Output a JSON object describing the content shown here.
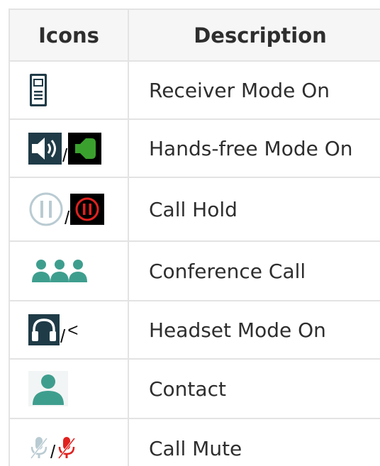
{
  "table": {
    "headers": {
      "icons": "Icons",
      "description": "Description"
    },
    "rows": [
      {
        "icons": [
          "receiver-icon"
        ],
        "separator": "",
        "suffix": "",
        "description": "Receiver Mode On"
      },
      {
        "icons": [
          "speaker-icon",
          "speaker-active-icon"
        ],
        "separator": "/",
        "suffix": "",
        "description": "Hands-free Mode On"
      },
      {
        "icons": [
          "pause-icon",
          "pause-active-icon"
        ],
        "separator": "/",
        "suffix": "",
        "description": "Call Hold"
      },
      {
        "icons": [
          "conference-icon"
        ],
        "separator": "",
        "suffix": "",
        "description": "Conference Call"
      },
      {
        "icons": [
          "headset-icon"
        ],
        "separator": "/",
        "suffix": "<",
        "description": "Headset Mode On"
      },
      {
        "icons": [
          "contact-icon"
        ],
        "separator": "",
        "suffix": "",
        "description": "Contact"
      },
      {
        "icons": [
          "mic-icon",
          "mic-muted-icon"
        ],
        "separator": "/",
        "suffix": "",
        "description": "Call Mute"
      }
    ]
  },
  "colors": {
    "teal": "#3e9e8e",
    "green": "#3aa12e",
    "red": "#e0221f",
    "icon_dark": "#1f3b47",
    "grid": "#e3e3e3",
    "header_bg": "#f6f6f6"
  }
}
